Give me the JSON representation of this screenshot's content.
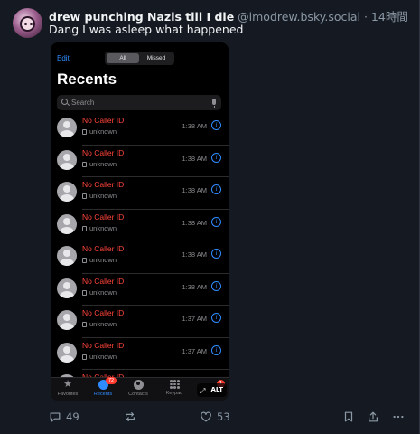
{
  "post": {
    "author_name": "drew punching Nazis till I die",
    "handle": "@imodrew.bsky.social",
    "separator": "·",
    "time": "14時間",
    "text": "Dang I was asleep what happened"
  },
  "image": {
    "alt_label": "ALT",
    "voicemail_badge": "1",
    "phone": {
      "edit_label": "Edit",
      "segment_all": "All",
      "segment_missed": "Missed",
      "title": "Recents",
      "search_placeholder": "Search",
      "calls": [
        {
          "name": "No Caller ID",
          "type": "unknown",
          "time": "1:38 AM"
        },
        {
          "name": "No Caller ID",
          "type": "unknown",
          "time": "1:38 AM"
        },
        {
          "name": "No Caller ID",
          "type": "unknown",
          "time": "1:38 AM"
        },
        {
          "name": "No Caller ID",
          "type": "unknown",
          "time": "1:38 AM"
        },
        {
          "name": "No Caller ID",
          "type": "unknown",
          "time": "1:38 AM"
        },
        {
          "name": "No Caller ID",
          "type": "unknown",
          "time": "1:38 AM"
        },
        {
          "name": "No Caller ID",
          "type": "unknown",
          "time": "1:37 AM"
        },
        {
          "name": "No Caller ID",
          "type": "unknown",
          "time": "1:37 AM"
        },
        {
          "name": "No Caller ID",
          "type": "",
          "time": ""
        }
      ],
      "tabs": [
        {
          "label": "Favorites",
          "icon": "star-icon"
        },
        {
          "label": "Recents",
          "icon": "clock-icon",
          "badge": "72"
        },
        {
          "label": "Contacts",
          "icon": "person-icon"
        },
        {
          "label": "Keypad",
          "icon": "keypad-icon"
        },
        {
          "label": "",
          "icon": "voicemail-icon"
        }
      ]
    }
  },
  "actions": {
    "reply_count": "49",
    "like_count": "53"
  },
  "colors": {
    "background": "#151a22",
    "accent_blue": "#2f8cff",
    "missed_red": "#ff453a",
    "muted": "#8b98a5"
  }
}
